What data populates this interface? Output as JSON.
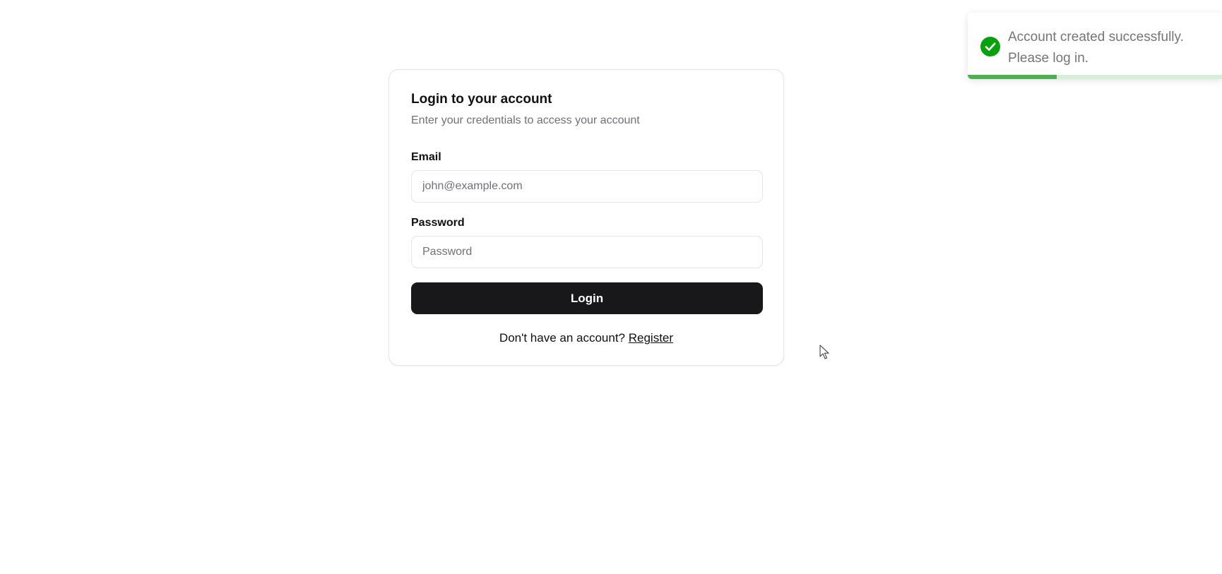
{
  "login": {
    "title": "Login to your account",
    "subtitle": "Enter your credentials to access your account",
    "email_label": "Email",
    "email_placeholder": "john@example.com",
    "email_value": "",
    "password_label": "Password",
    "password_placeholder": "Password",
    "password_value": "",
    "submit_label": "Login",
    "register_prompt": "Don't have an account?",
    "register_link": "Register"
  },
  "toast": {
    "message_line1": "Account created successfully.",
    "message_line2": "Please log in.",
    "icon": "check-circle-icon",
    "status_color": "#07a10d",
    "progress": 0.35
  },
  "colors": {
    "primary_button": "#18181b",
    "toast_progress": "#4caf50",
    "toast_track": "#d5f2d6"
  }
}
